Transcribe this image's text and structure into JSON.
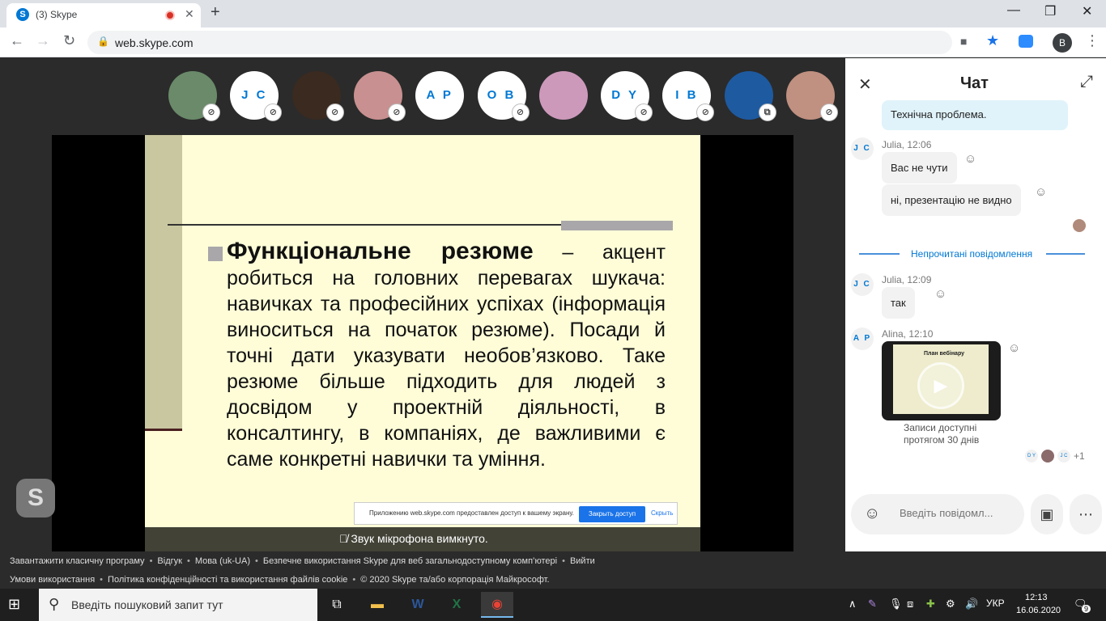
{
  "browser": {
    "tab_title": "(3) Skype",
    "url": "web.skype.com",
    "profile_initial": "B"
  },
  "participants": [
    {
      "initials": "",
      "photo": true,
      "muted": true
    },
    {
      "initials": "J C",
      "photo": false,
      "muted": true
    },
    {
      "initials": "",
      "photo": true,
      "muted": true
    },
    {
      "initials": "",
      "photo": true,
      "muted": true
    },
    {
      "initials": "A P",
      "photo": false,
      "muted": false
    },
    {
      "initials": "O B",
      "photo": false,
      "muted": true
    },
    {
      "initials": "",
      "photo": true,
      "muted": false
    },
    {
      "initials": "D Y",
      "photo": false,
      "muted": true
    },
    {
      "initials": "I B",
      "photo": false,
      "muted": true
    },
    {
      "initials": "",
      "photo": true,
      "muted": false,
      "screen_sharing": true
    },
    {
      "initials": "",
      "photo": true,
      "muted": true
    }
  ],
  "slide": {
    "heading": "Функціональне резюме",
    "body": " – акцент робиться на головних перевагах шукача: навичках та професійних успіхах (інформація виноситься на початок резюме). Посади й точні дати указувати необов’язково. Таке резюме більше підходить для людей з досвідом у проектній діяльності, в консалтингу, в компаніях, де важливими є саме конкретні навички та уміння."
  },
  "share_notice": {
    "text": "Приложению web.skype.com предоставлен доступ к вашему экрану.",
    "stop_label": "Закрыть доступ",
    "hide_label": "Скрыть"
  },
  "mic_status": "Звук мікрофона вимкнуто.",
  "chat": {
    "title": "Чат",
    "messages": [
      {
        "text": "Технічна проблема."
      },
      {
        "initials": "J C",
        "meta": "Julia, 12:06",
        "text": "Вас не чути"
      },
      {
        "text": "ні, презентацію не видно"
      },
      {
        "initials": "J C",
        "meta": "Julia, 12:09",
        "text": "так"
      },
      {
        "initials": "A P",
        "meta": "Alina, 12:10"
      }
    ],
    "unread_label": "Непрочитані повідомлення",
    "video": {
      "slide_title": "План вебінару",
      "caption": "Записи доступні протягом 30 днів"
    },
    "seen": [
      "D Y",
      "",
      "J C"
    ],
    "seen_more": "+1",
    "compose_placeholder": "Введіть повідомл..."
  },
  "footer": {
    "row1": [
      "Завантажити класичну програму",
      "Відгук",
      "Мова (uk-UA)",
      "Безпечне використання Skype для веб загальнодоступному комп’ютері",
      "Вийти"
    ],
    "row2": [
      "Умови використання",
      "Політика конфіденційності та використання файлів cookie",
      "© 2020 Skype та/або корпорація Майкрософт."
    ]
  },
  "taskbar": {
    "search_placeholder": "Введіть пошуковий запит тут",
    "lang": "УКР",
    "time": "12:13",
    "date": "16.06.2020",
    "notifications": "9"
  },
  "colors": {
    "accent": "#0078d4",
    "slide_bg": "#fefdd8",
    "call_bg": "#2b2b2b"
  }
}
